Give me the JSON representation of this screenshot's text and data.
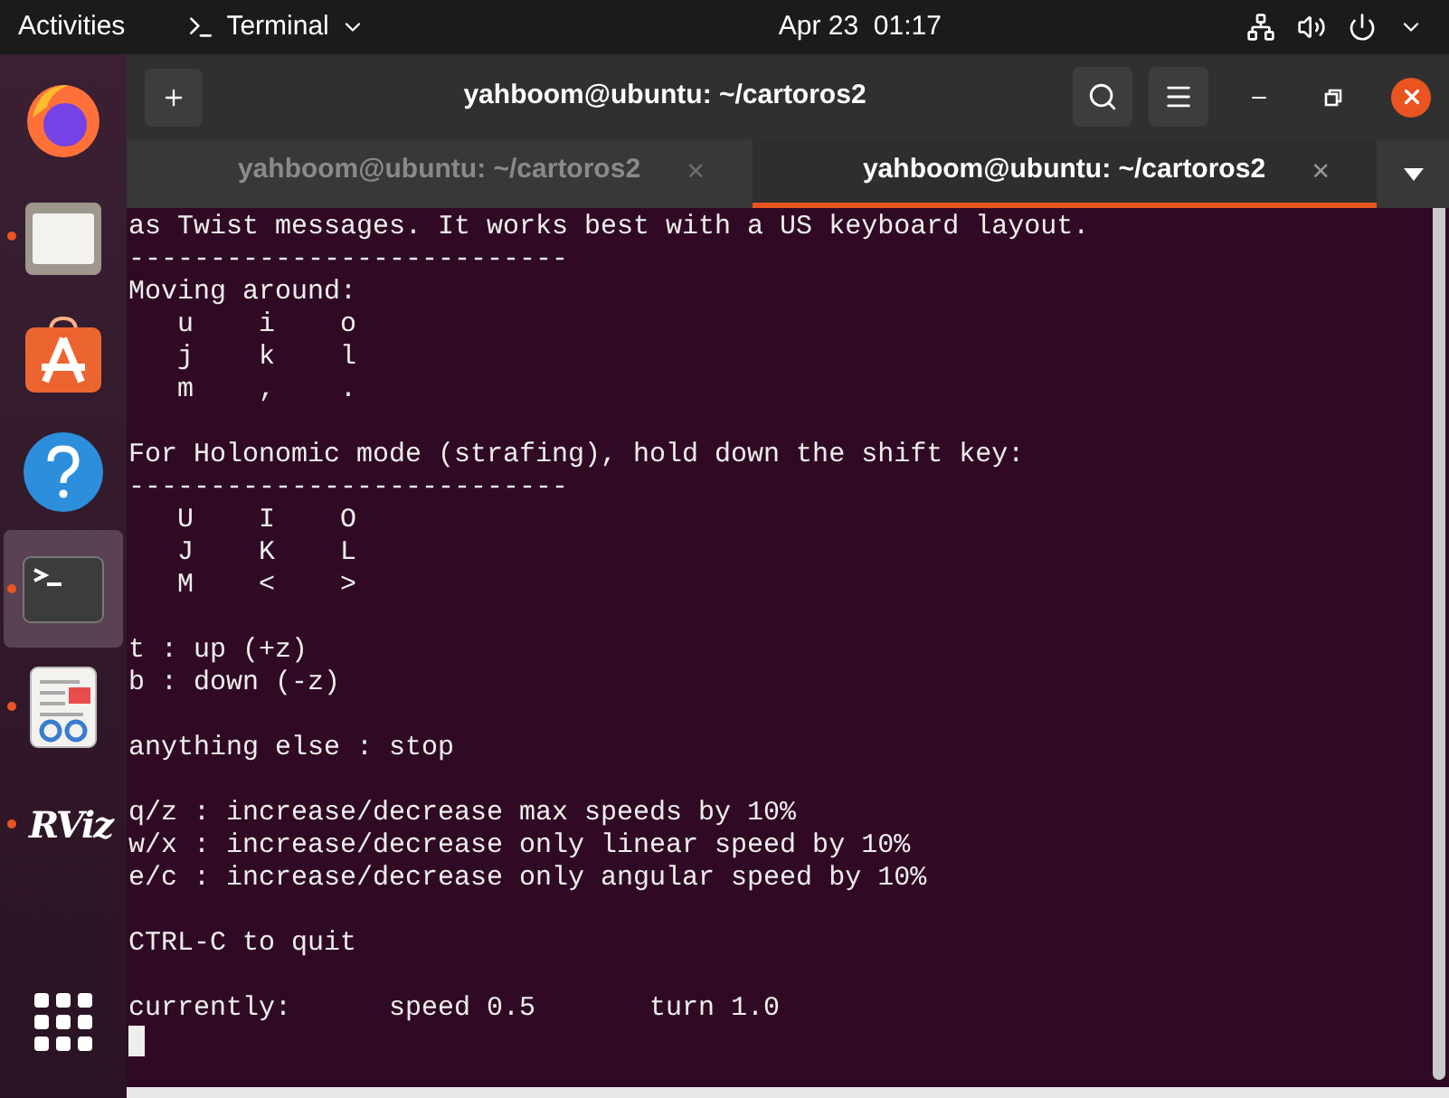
{
  "top_bar": {
    "activities": "Activities",
    "app_menu": "Terminal",
    "clock": "Apr 23  01:17"
  },
  "dock": [
    {
      "kind": "firefox",
      "running": false,
      "selected": false
    },
    {
      "kind": "files",
      "running": true,
      "selected": false
    },
    {
      "kind": "software",
      "running": false,
      "selected": false
    },
    {
      "kind": "help",
      "running": false,
      "selected": false
    },
    {
      "kind": "terminal",
      "running": true,
      "selected": true
    },
    {
      "kind": "reader",
      "running": true,
      "selected": false
    },
    {
      "kind": "rviz",
      "running": true,
      "selected": false,
      "label": "RViz"
    },
    {
      "kind": "apps",
      "running": false,
      "selected": false
    }
  ],
  "window": {
    "title": "yahboom@ubuntu: ~/cartoros2"
  },
  "tabs": [
    {
      "label": "yahboom@ubuntu: ~/cartoros2",
      "close": "×",
      "selected": false
    },
    {
      "label": "yahboom@ubuntu: ~/cartoros2",
      "close": "×",
      "selected": true
    }
  ],
  "terminal": {
    "blocks": [
      [
        "as Twist messages. It works best with a US keyboard layout.",
        "---------------------------",
        "Moving around:",
        "   u    i    o",
        "   j    k    l",
        "   m    ,    ."
      ],
      [
        "For Holonomic mode (strafing), hold down the shift key:",
        "---------------------------",
        "   U    I    O",
        "   J    K    L",
        "   M    <    >"
      ],
      [
        "t : up (+z)",
        "b : down (-z)"
      ],
      [
        "anything else : stop"
      ],
      [
        "q/z : increase/decrease max speeds by 10%",
        "w/x : increase/decrease only linear speed by 10%",
        "e/c : increase/decrease only angular speed by 10%"
      ],
      [
        "CTRL-C to quit"
      ],
      [
        "currently:      speed 0.5       turn 1.0"
      ]
    ],
    "cursor": true
  }
}
